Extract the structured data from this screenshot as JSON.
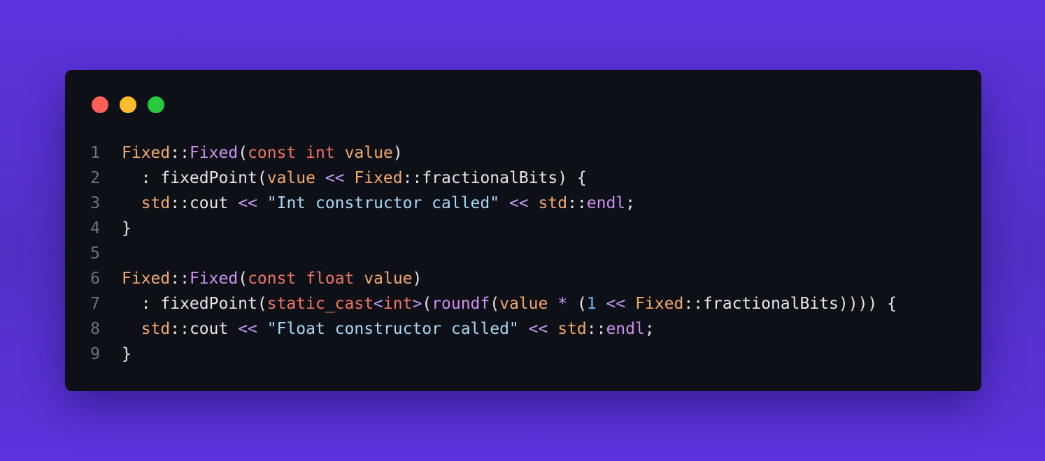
{
  "window": {
    "controls": [
      {
        "name": "close",
        "color": "#ff5f57"
      },
      {
        "name": "minimize",
        "color": "#febc2e"
      },
      {
        "name": "maximize",
        "color": "#28c840"
      }
    ]
  },
  "code": {
    "language": "cpp",
    "lines": [
      {
        "number": "1",
        "tokens": [
          {
            "t": "Fixed",
            "k": "type"
          },
          {
            "t": "::",
            "k": "plain"
          },
          {
            "t": "Fixed",
            "k": "fn"
          },
          {
            "t": "(",
            "k": "plain"
          },
          {
            "t": "const",
            "k": "kw"
          },
          {
            "t": " ",
            "k": "plain"
          },
          {
            "t": "int",
            "k": "kw"
          },
          {
            "t": " ",
            "k": "plain"
          },
          {
            "t": "value",
            "k": "type"
          },
          {
            "t": ")",
            "k": "plain"
          }
        ]
      },
      {
        "number": "2",
        "tokens": [
          {
            "t": "  : fixedPoint(",
            "k": "plain"
          },
          {
            "t": "value",
            "k": "type"
          },
          {
            "t": " ",
            "k": "plain"
          },
          {
            "t": "<<",
            "k": "op"
          },
          {
            "t": " ",
            "k": "plain"
          },
          {
            "t": "Fixed",
            "k": "type"
          },
          {
            "t": "::fractionalBits) {",
            "k": "plain"
          }
        ]
      },
      {
        "number": "3",
        "tokens": [
          {
            "t": "  ",
            "k": "plain"
          },
          {
            "t": "std",
            "k": "type"
          },
          {
            "t": "::cout ",
            "k": "plain"
          },
          {
            "t": "<<",
            "k": "op"
          },
          {
            "t": " ",
            "k": "plain"
          },
          {
            "t": "\"Int constructor called\"",
            "k": "str"
          },
          {
            "t": " ",
            "k": "plain"
          },
          {
            "t": "<<",
            "k": "op"
          },
          {
            "t": " ",
            "k": "plain"
          },
          {
            "t": "std",
            "k": "type"
          },
          {
            "t": "::",
            "k": "plain"
          },
          {
            "t": "endl",
            "k": "fn"
          },
          {
            "t": ";",
            "k": "plain"
          }
        ]
      },
      {
        "number": "4",
        "tokens": [
          {
            "t": "}",
            "k": "plain"
          }
        ]
      },
      {
        "number": "5",
        "tokens": []
      },
      {
        "number": "6",
        "tokens": [
          {
            "t": "Fixed",
            "k": "type"
          },
          {
            "t": "::",
            "k": "plain"
          },
          {
            "t": "Fixed",
            "k": "fn"
          },
          {
            "t": "(",
            "k": "plain"
          },
          {
            "t": "const",
            "k": "kw"
          },
          {
            "t": " ",
            "k": "plain"
          },
          {
            "t": "float",
            "k": "kw"
          },
          {
            "t": " ",
            "k": "plain"
          },
          {
            "t": "value",
            "k": "type"
          },
          {
            "t": ")",
            "k": "plain"
          }
        ]
      },
      {
        "number": "7",
        "tokens": [
          {
            "t": "  : fixedPoint(",
            "k": "plain"
          },
          {
            "t": "static_cast",
            "k": "kw"
          },
          {
            "t": "<",
            "k": "op"
          },
          {
            "t": "int",
            "k": "kw"
          },
          {
            "t": ">",
            "k": "op"
          },
          {
            "t": "(",
            "k": "plain"
          },
          {
            "t": "roundf",
            "k": "fn"
          },
          {
            "t": "(",
            "k": "plain"
          },
          {
            "t": "value",
            "k": "type"
          },
          {
            "t": " ",
            "k": "plain"
          },
          {
            "t": "*",
            "k": "op"
          },
          {
            "t": " (",
            "k": "plain"
          },
          {
            "t": "1",
            "k": "num"
          },
          {
            "t": " ",
            "k": "plain"
          },
          {
            "t": "<<",
            "k": "op"
          },
          {
            "t": " ",
            "k": "plain"
          },
          {
            "t": "Fixed",
            "k": "type"
          },
          {
            "t": "::fractionalBits)))) {",
            "k": "plain"
          }
        ]
      },
      {
        "number": "8",
        "tokens": [
          {
            "t": "  ",
            "k": "plain"
          },
          {
            "t": "std",
            "k": "type"
          },
          {
            "t": "::cout ",
            "k": "plain"
          },
          {
            "t": "<<",
            "k": "op"
          },
          {
            "t": " ",
            "k": "plain"
          },
          {
            "t": "\"Float constructor called\"",
            "k": "str"
          },
          {
            "t": " ",
            "k": "plain"
          },
          {
            "t": "<<",
            "k": "op"
          },
          {
            "t": " ",
            "k": "plain"
          },
          {
            "t": "std",
            "k": "type"
          },
          {
            "t": "::",
            "k": "plain"
          },
          {
            "t": "endl",
            "k": "fn"
          },
          {
            "t": ";",
            "k": "plain"
          }
        ]
      },
      {
        "number": "9",
        "tokens": [
          {
            "t": "}",
            "k": "plain"
          }
        ]
      }
    ]
  }
}
